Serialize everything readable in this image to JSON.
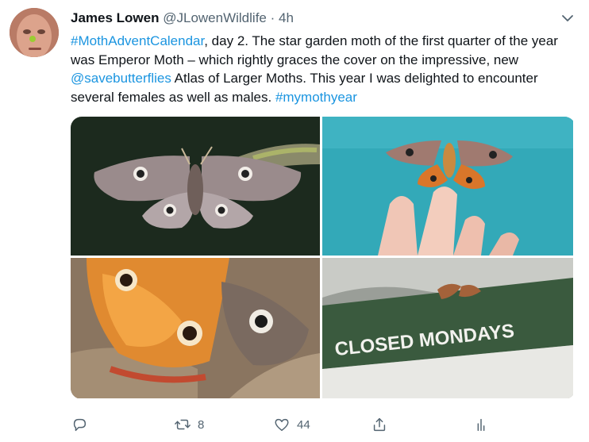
{
  "tweet": {
    "author_name": "James Lowen",
    "author_handle": "@JLowenWildlife",
    "separator": "·",
    "time": "4h",
    "text": {
      "hashtag1": "#MothAdventCalendar",
      "part1": ", day 2. The star garden moth of the first quarter of the year was Emperor Moth – which rightly graces the cover on the impressive, new ",
      "mention": "@savebutterflies",
      "part2": " Atlas of Larger Moths. This year I was delighted to encounter several females as well as males. ",
      "hashtag2": "#mymothyear"
    }
  },
  "media": {
    "sign_text": "CLOSED MONDAYS"
  },
  "actions": {
    "retweet_count": "8",
    "like_count": "44"
  },
  "icons": [
    "chevron-down-icon",
    "reply-icon",
    "retweet-icon",
    "like-icon",
    "share-icon",
    "analytics-icon"
  ],
  "colors": {
    "link": "#1b95e0",
    "secondary": "#536471"
  }
}
